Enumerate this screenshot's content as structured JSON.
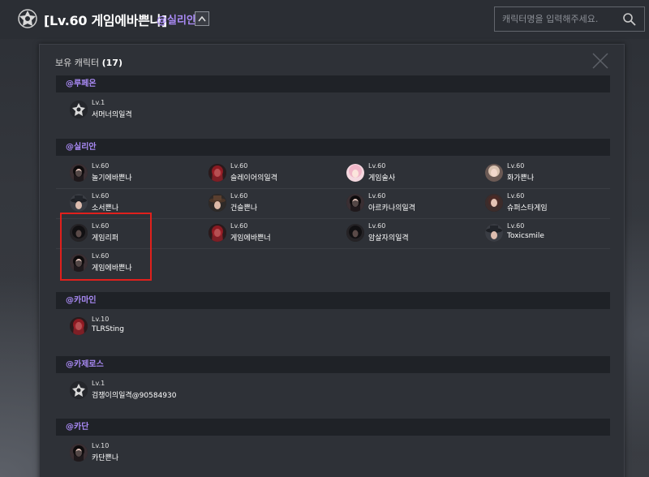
{
  "header": {
    "title": "[Lv.60 게임에바쁜나]",
    "account": "@실리안",
    "search_placeholder": "캐릭터명을 입력해주세요."
  },
  "modal": {
    "title_prefix": "보유 캐릭터",
    "count": "(17)"
  },
  "groups": [
    {
      "name": "@루페온",
      "characters": [
        {
          "level": "Lv.1",
          "name": "서머너의일격",
          "avatar": "emblem"
        }
      ]
    },
    {
      "name": "@실리안",
      "characters": [
        {
          "level": "Lv.60",
          "name": "놀기에바쁜나",
          "avatar": "dark-hair"
        },
        {
          "level": "Lv.60",
          "name": "슬레이어의일격",
          "avatar": "red-hair"
        },
        {
          "level": "Lv.60",
          "name": "게임술사",
          "avatar": "pink-hair"
        },
        {
          "level": "Lv.60",
          "name": "화가쁜나",
          "avatar": "light-hair"
        },
        {
          "level": "Lv.60",
          "name": "소서쁜나",
          "avatar": "hat"
        },
        {
          "level": "Lv.60",
          "name": "건슬쁜나",
          "avatar": "hat-brown"
        },
        {
          "level": "Lv.60",
          "name": "아르카나의일격",
          "avatar": "dark-hair"
        },
        {
          "level": "Lv.60",
          "name": "슈퍼스타게임",
          "avatar": "brown-hair"
        },
        {
          "level": "Lv.60",
          "name": "게임리퍼",
          "avatar": "dark-mask"
        },
        {
          "level": "Lv.60",
          "name": "게임에바쁜너",
          "avatar": "red-hair"
        },
        {
          "level": "Lv.60",
          "name": "암살자의일격",
          "avatar": "dark-mask"
        },
        {
          "level": "Lv.60",
          "name": "Toxicsmile",
          "avatar": "hat"
        },
        {
          "level": "Lv.60",
          "name": "게임에바쁜나",
          "avatar": "dark-hair"
        }
      ]
    },
    {
      "name": "@카마인",
      "characters": [
        {
          "level": "Lv.10",
          "name": "TLRSting",
          "avatar": "red-hair"
        }
      ]
    },
    {
      "name": "@카제로스",
      "characters": [
        {
          "level": "Lv.1",
          "name": "검쟁이의일격@90584930",
          "avatar": "emblem"
        }
      ]
    },
    {
      "name": "@카단",
      "characters": [
        {
          "level": "Lv.10",
          "name": "카단쁜나",
          "avatar": "dark-hair"
        }
      ]
    }
  ],
  "colors": {
    "accent": "#a98af5",
    "highlight": "#e0201c"
  }
}
